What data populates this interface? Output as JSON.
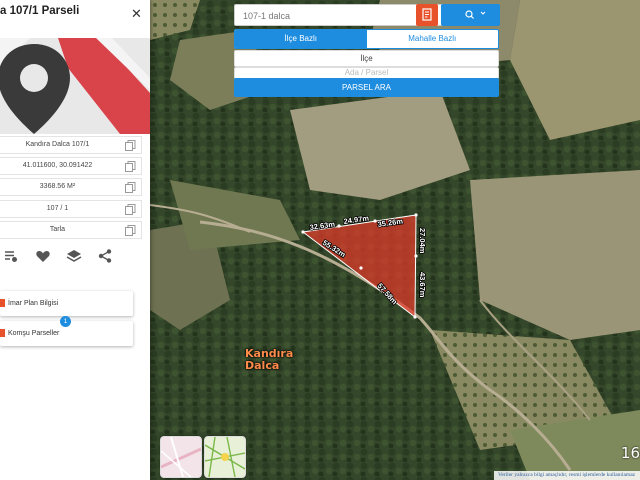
{
  "panel": {
    "title": "a 107/1 Parseli",
    "info_rows": [
      {
        "text": "Kandıra Dalca 107/1"
      },
      {
        "text": "41.011600, 30.091422"
      },
      {
        "text": "3368.56 M²"
      },
      {
        "text": "107 / 1"
      },
      {
        "text": "Tarla"
      }
    ],
    "actions": [
      "filter-list-icon",
      "heart-icon",
      "layers-icon",
      "share-icon"
    ],
    "menu": [
      {
        "label": "İmar Plan Bilgisi",
        "icon": "document-icon"
      },
      {
        "label": "Komşu Parseller",
        "icon": "map-icon",
        "badge": "1"
      }
    ]
  },
  "search": {
    "query": "107-1 dalca",
    "tabs": [
      {
        "label": "İlçe Bazlı",
        "active": true
      },
      {
        "label": "Mahalle Bazlı",
        "active": false
      }
    ],
    "district": "İlçe",
    "block_placeholder": "Ada / Parsel",
    "submit_label": "PARSEL ARA",
    "accent": "#1e8de0",
    "orange": "#e8522a"
  },
  "map": {
    "place": [
      "Kandıra",
      "Dalca"
    ],
    "edges": [
      "32.63m",
      "24.97m",
      "35.26m",
      "27.04m",
      "43.67m",
      "57.58m",
      "55.32m"
    ],
    "zoom": "16",
    "disclaimer": "Veriler yalnızca bilgi amaçlıdır, resmi işlemlerde kullanılamaz",
    "parcel_color": "#e23a2a"
  }
}
